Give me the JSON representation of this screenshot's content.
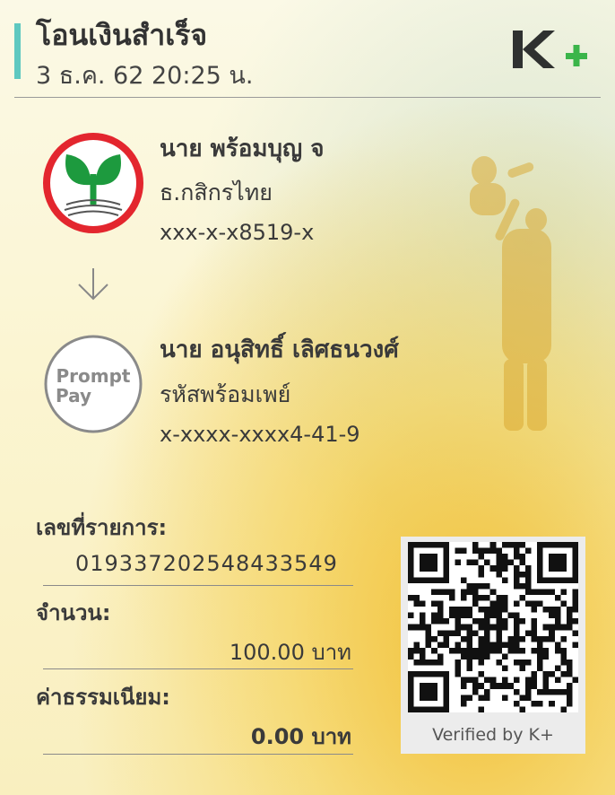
{
  "header": {
    "title": "โอนเงินสำเร็จ",
    "datetime": "3 ธ.ค. 62  20:25 น.",
    "logo": "K+",
    "accent_color": "#5ec8c0",
    "logo_green": "#3bb54a"
  },
  "sender": {
    "name": "นาย พร้อมบุญ จ",
    "bank": "ธ.กสิกรไทย",
    "account": "xxx-x-x8519-x",
    "logo_icon": "kbank-logo"
  },
  "receiver": {
    "name": "นาย อนุสิทธิ์ เลิศธนวงศ์",
    "bank": "รหัสพร้อมเพย์",
    "account": "x-xxxx-xxxx4-41-9",
    "logo_line1": "Prompt",
    "logo_line2": "Pay"
  },
  "details": {
    "ref_label": "เลขที่รายการ:",
    "ref_value": "019337202548433549",
    "amount_label": "จำนวน:",
    "amount_value": "100.00 บาท",
    "fee_label": "ค่าธรรมเนียม:",
    "fee_value": "0.00 บาท"
  },
  "qr": {
    "verified_text": "Verified by K+"
  }
}
